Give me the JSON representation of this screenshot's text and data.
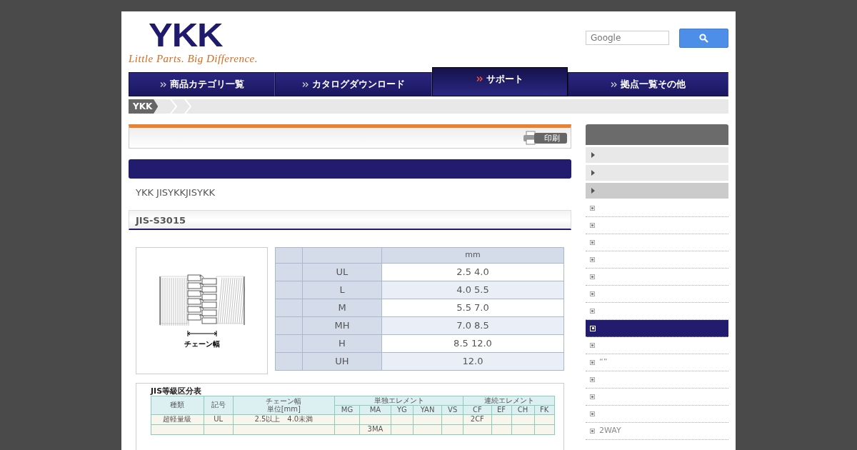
{
  "logo": {
    "mark": "YKK",
    "tagline": "Little Parts. Big Difference."
  },
  "search": {
    "placeholder": "Google"
  },
  "nav": [
    {
      "label": "商品カテゴリ一覧",
      "selected": false
    },
    {
      "label": "カタログダウンロード",
      "selected": false
    },
    {
      "label": "サポート",
      "selected": true
    },
    {
      "label": "拠点一覧その他",
      "selected": false
    }
  ],
  "breadcrumb": [
    "YKK"
  ],
  "print_button": "印刷",
  "intro": "YKK JISYKKJISYKK",
  "section_title": "JIS-S3015",
  "figure_caption": "チェーン幅",
  "size_table": {
    "unit": "mm",
    "rows": [
      {
        "label": "UL",
        "value": "2.5 4.0"
      },
      {
        "label": "L",
        "value": "4.0 5.5"
      },
      {
        "label": "M",
        "value": "5.5 7.0"
      },
      {
        "label": "MH",
        "value": "7.0 8.5"
      },
      {
        "label": "H",
        "value": "8.5 12.0"
      },
      {
        "label": "UH",
        "value": "12.0"
      }
    ]
  },
  "jis_table": {
    "title": "JIS等級区分表",
    "col_kind": "種類",
    "col_code": "記号",
    "col_width": "チェーン幅",
    "col_unit": "単位[mm]",
    "group_single": "単独エレメント",
    "group_chain": "連続エレメント",
    "single": [
      "MG",
      "MA",
      "YG",
      "YAN",
      "VS"
    ],
    "chain": [
      "CF",
      "EF",
      "CH",
      "FK"
    ],
    "rows": [
      {
        "kind": "超軽量級",
        "code": "UL",
        "width": "2.5以上　4.0未満",
        "cells": [
          "",
          "",
          "",
          "",
          "",
          "2CF",
          "",
          "",
          ""
        ]
      },
      {
        "kind": "",
        "code": "",
        "width": "",
        "cells": [
          "",
          "3MA",
          "",
          "",
          "",
          "",
          "",
          "",
          ""
        ]
      }
    ]
  },
  "sidebar": {
    "sections": [
      {
        "selected": false
      },
      {
        "selected": false
      },
      {
        "selected": true
      }
    ],
    "items": [
      {
        "selected": false
      },
      {
        "selected": false
      },
      {
        "selected": false
      },
      {
        "selected": false
      },
      {
        "selected": false
      },
      {
        "selected": false
      },
      {
        "selected": false
      },
      {
        "selected": true
      },
      {
        "selected": false
      },
      {
        "selected": false,
        "text": "“”"
      },
      {
        "selected": false
      },
      {
        "selected": false
      },
      {
        "selected": false
      },
      {
        "selected": false,
        "text": "2WAY"
      }
    ]
  }
}
